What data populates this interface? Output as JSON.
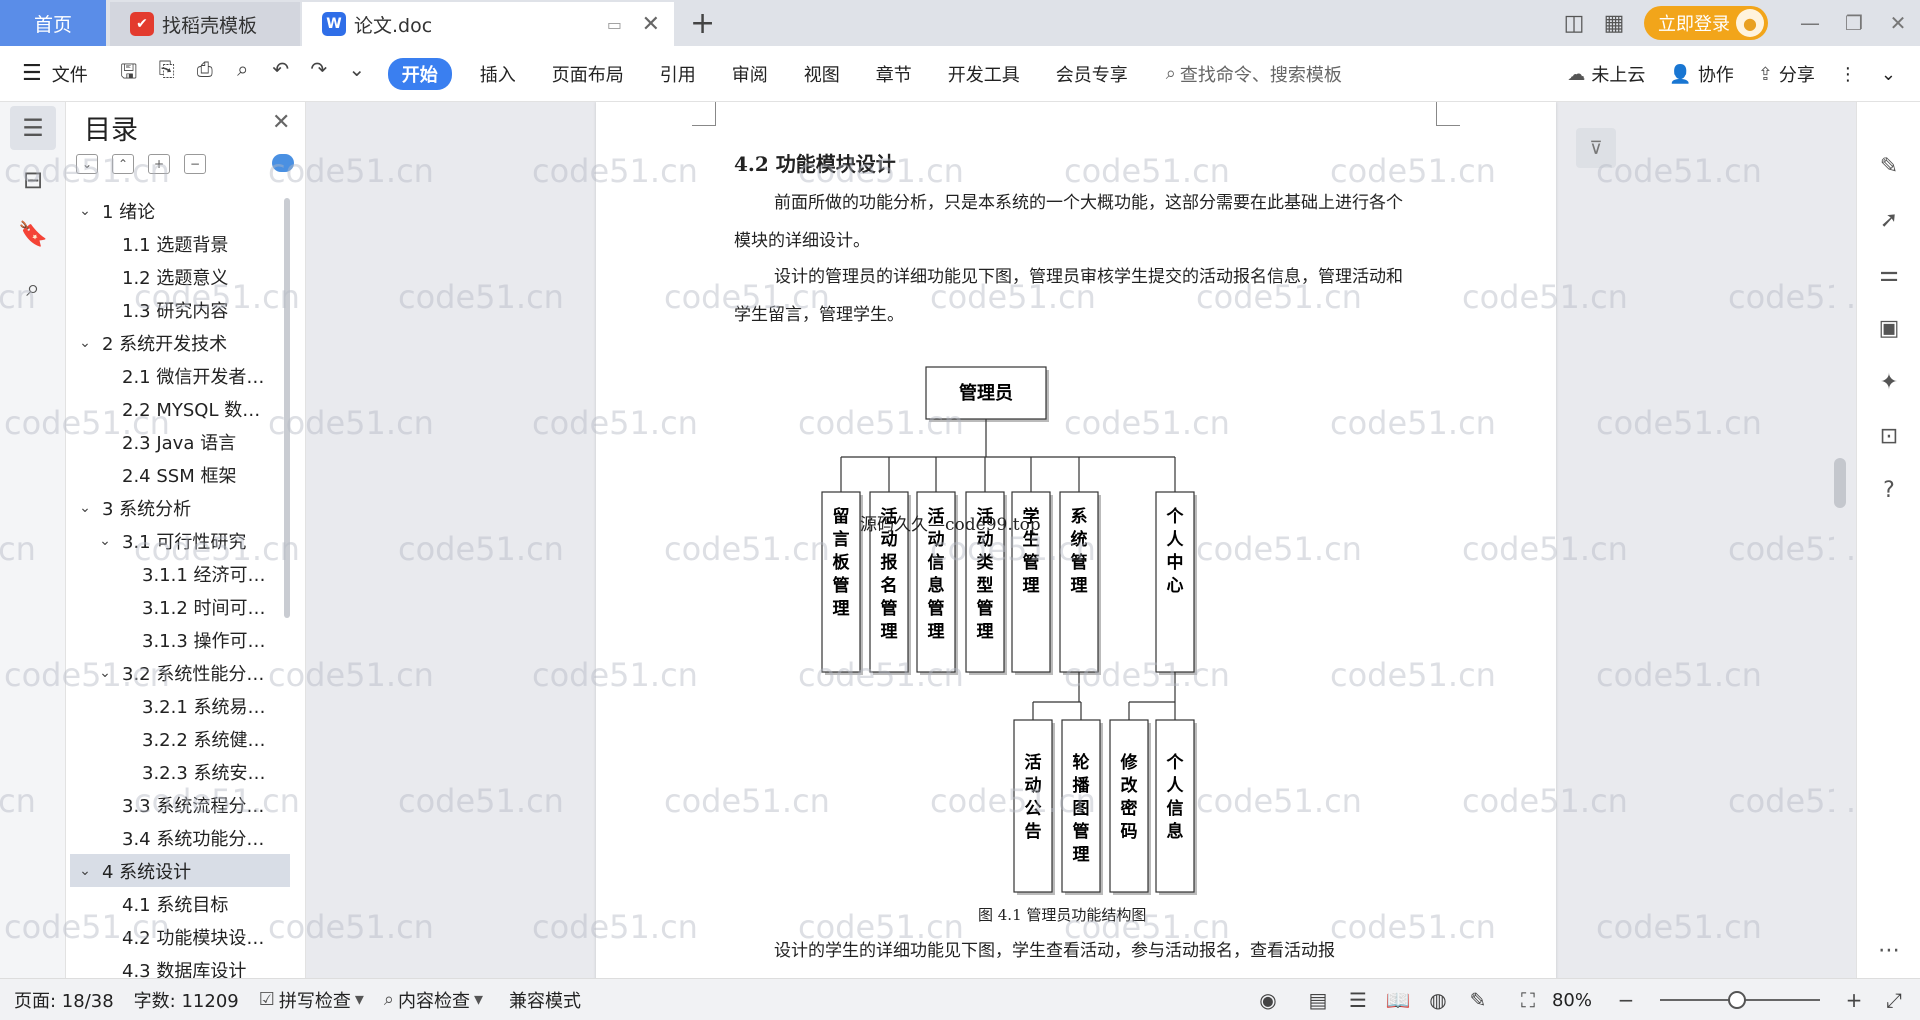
{
  "titlebar": {
    "home_tab": "首页",
    "tabs": [
      {
        "label": "找稻壳模板",
        "icon": "daoke-icon"
      },
      {
        "label": "论文.doc",
        "icon": "wps-writer-icon"
      }
    ],
    "login_label": "立即登录"
  },
  "ribbon": {
    "file_label": "文件",
    "menu": [
      "开始",
      "插入",
      "页面布局",
      "引用",
      "审阅",
      "视图",
      "章节",
      "开发工具",
      "会员专享"
    ],
    "active_menu": "开始",
    "search_placeholder": "查找命令、搜索模板",
    "right": {
      "cloud": "未上云",
      "collab": "协作",
      "share": "分享"
    }
  },
  "toc": {
    "title": "目录",
    "items": [
      {
        "label": "1  绪论",
        "level": 0,
        "expanded": true
      },
      {
        "label": "1.1  选题背景",
        "level": 1
      },
      {
        "label": "1.2  选题意义",
        "level": 1
      },
      {
        "label": "1.3  研究内容",
        "level": 1
      },
      {
        "label": "2  系统开发技术",
        "level": 0,
        "expanded": true
      },
      {
        "label": "2.1 微信开发者…",
        "level": 1
      },
      {
        "label": "2.2 MYSQL 数…",
        "level": 1
      },
      {
        "label": "2.3 Java 语言",
        "level": 1
      },
      {
        "label": "2.4 SSM 框架",
        "level": 1
      },
      {
        "label": "3  系统分析",
        "level": 0,
        "expanded": true
      },
      {
        "label": "3.1 可行性研究",
        "level": 1,
        "expanded": true
      },
      {
        "label": "3.1.1 经济可…",
        "level": 2
      },
      {
        "label": "3.1.2 时间可…",
        "level": 2
      },
      {
        "label": "3.1.3 操作可…",
        "level": 2
      },
      {
        "label": "3.2 系统性能分…",
        "level": 1,
        "expanded": true
      },
      {
        "label": "3.2.1 系统易…",
        "level": 2
      },
      {
        "label": "3.2.2 系统健…",
        "level": 2
      },
      {
        "label": "3.2.3 系统安…",
        "level": 2
      },
      {
        "label": "3.3  系统流程分…",
        "level": 1
      },
      {
        "label": "3.4 系统功能分…",
        "level": 1
      },
      {
        "label": "4  系统设计",
        "level": 0,
        "expanded": true,
        "selected": true
      },
      {
        "label": "4.1 系统目标",
        "level": 1
      },
      {
        "label": "4.2 功能模块设…",
        "level": 1
      },
      {
        "label": "4.3 数据库设计",
        "level": 1
      }
    ]
  },
  "document": {
    "heading": "4.2 功能模块设计",
    "paragraphs": [
      "前面所做的功能分析，只是本系统的一个大概功能，这部分需要在此基础上进行各个模块的详细设计。",
      "设计的管理员的详细功能见下图，管理员审核学生提交的活动报名信息，管理活动和学生留言，管理学生。"
    ],
    "diagram": {
      "root": "管理员",
      "level1": [
        "留言板管理",
        "活动报名管理",
        "活动信息管理",
        "活动类型管理",
        "学生管理",
        "系统管理",
        "个人中心"
      ],
      "system_children": [
        "活动公告",
        "轮播图管理"
      ],
      "personal_children": [
        "修改密码",
        "个人信息"
      ]
    },
    "overlay_text": "源码久久—code99.top",
    "caption": "图 4.1  管理员功能结构图",
    "bottom_paragraph": "设计的学生的详细功能见下图，学生查看活动，参与活动报名，查看活动报",
    "watermark": "code51.cn"
  },
  "statusbar": {
    "page": "页面: 18/38",
    "words": "字数: 11209",
    "spell": "拼写检查",
    "content": "内容检查",
    "compat": "兼容模式",
    "zoom": "80%"
  }
}
